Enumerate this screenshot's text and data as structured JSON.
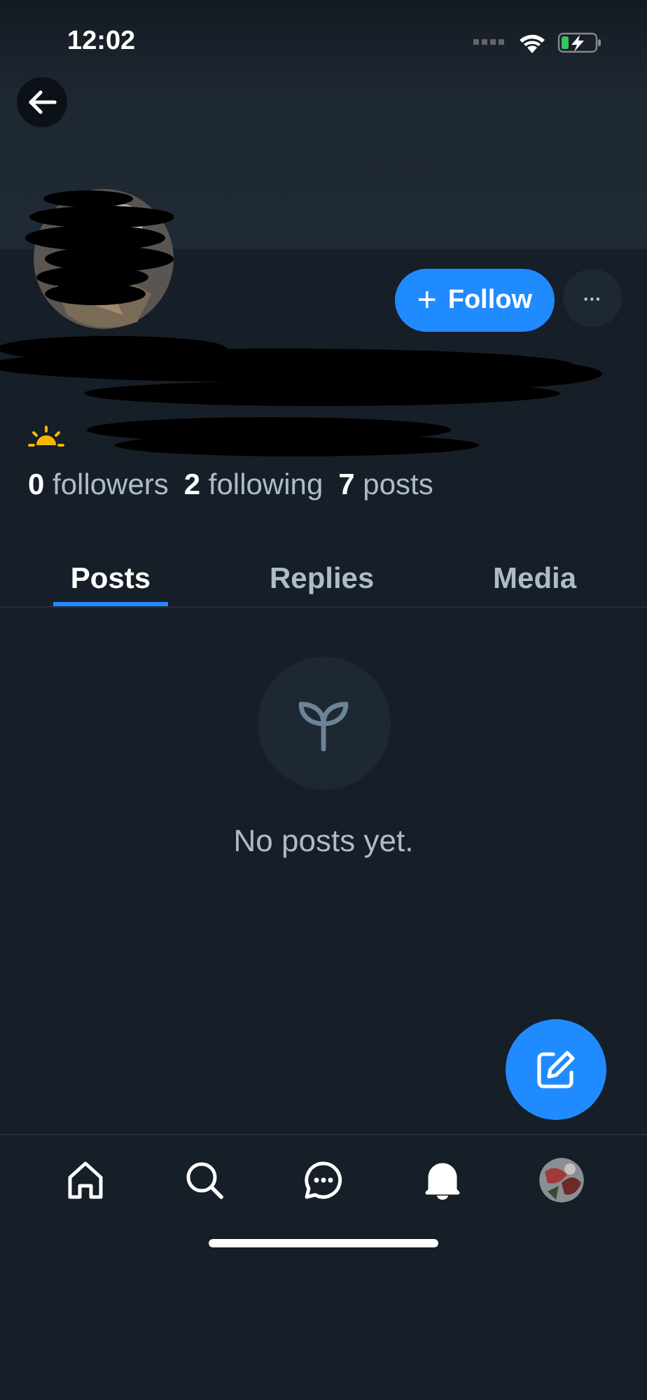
{
  "status_bar": {
    "time": "12:02"
  },
  "profile": {
    "follow_button": "Follow",
    "follow_icon": "+",
    "more_button": "···",
    "stats": [
      {
        "count": "0",
        "label": "followers"
      },
      {
        "count": "2",
        "label": "following"
      },
      {
        "count": "7",
        "label": "posts"
      }
    ]
  },
  "tabs": [
    {
      "label": "Posts",
      "selected": true
    },
    {
      "label": "Replies",
      "selected": false
    },
    {
      "label": "Media",
      "selected": false
    }
  ],
  "empty_state": {
    "message": "No posts yet."
  },
  "bottom_nav": [
    {
      "kind": "home",
      "selected": false
    },
    {
      "kind": "search",
      "selected": false
    },
    {
      "kind": "chat",
      "selected": false
    },
    {
      "kind": "bell",
      "selected": true
    },
    {
      "kind": "avatar",
      "selected": false
    }
  ]
}
